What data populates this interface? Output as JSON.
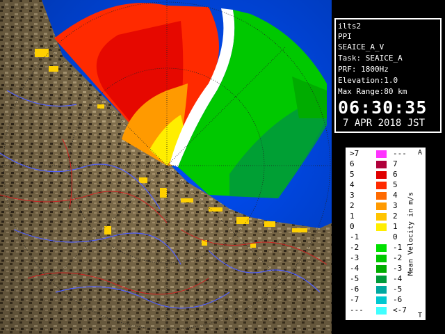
{
  "info": {
    "radar": "ilts2",
    "product": "PPI",
    "product_name": "SEAICE_A_V",
    "task": "Task: SEAICE_A",
    "prf": "PRF: 1800Hz",
    "elevation": "Elevation:1.0",
    "max_range": "Max Range:80 km",
    "time": "06:30:35",
    "date": "7 APR 2018 JST"
  },
  "legend": {
    "title": "Mean Velocity in m/s",
    "top_tag": "A",
    "bottom_tag": "T",
    "rows": [
      {
        "left": ">7",
        "right": "---",
        "color": "#ff33ff"
      },
      {
        "left": "6",
        "right": "7",
        "color": "#b0003a"
      },
      {
        "left": "5",
        "right": "6",
        "color": "#e00000"
      },
      {
        "left": "4",
        "right": "5",
        "color": "#ff2a00"
      },
      {
        "left": "3",
        "right": "4",
        "color": "#ff6a00"
      },
      {
        "left": "2",
        "right": "3",
        "color": "#ff9a00"
      },
      {
        "left": "1",
        "right": "2",
        "color": "#ffc400"
      },
      {
        "left": "0",
        "right": "1",
        "color": "#ffee00"
      },
      {
        "left": "-1",
        "right": "0",
        "color": "#ffffff"
      },
      {
        "left": "-2",
        "right": "-1",
        "color": "#00e000"
      },
      {
        "left": "-3",
        "right": "-2",
        "color": "#00c800"
      },
      {
        "left": "-4",
        "right": "-3",
        "color": "#00ac00"
      },
      {
        "left": "-5",
        "right": "-4",
        "color": "#009a3a"
      },
      {
        "left": "-6",
        "right": "-5",
        "color": "#00a8a0"
      },
      {
        "left": "-7",
        "right": "-6",
        "color": "#00c8d0"
      },
      {
        "left": "---",
        "right": "<-7",
        "color": "#40ffff"
      }
    ]
  },
  "colors": {
    "land": "#8a7550",
    "sea": "#0050ff",
    "river_blue": "#5060ff",
    "boundary_red": "#d02020"
  }
}
